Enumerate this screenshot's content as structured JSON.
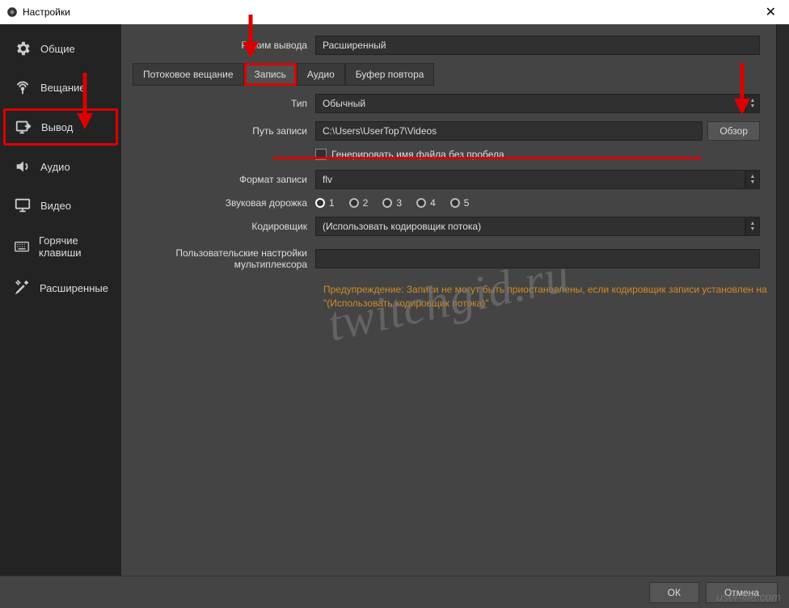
{
  "titlebar": {
    "title": "Настройки"
  },
  "sidebar": {
    "items": [
      {
        "label": "Общие",
        "icon": "gear-icon"
      },
      {
        "label": "Вещание",
        "icon": "antenna-icon"
      },
      {
        "label": "Вывод",
        "icon": "output-icon",
        "selected": true
      },
      {
        "label": "Аудио",
        "icon": "speaker-icon"
      },
      {
        "label": "Видео",
        "icon": "monitor-icon"
      },
      {
        "label": "Горячие клавиши",
        "icon": "keyboard-icon"
      },
      {
        "label": "Расширенные",
        "icon": "tools-icon"
      }
    ]
  },
  "mode": {
    "label": "Режим вывода",
    "value": "Расширенный"
  },
  "tabs": [
    {
      "label": "Потоковое вещание"
    },
    {
      "label": "Запись",
      "active": true
    },
    {
      "label": "Аудио"
    },
    {
      "label": "Буфер повтора"
    }
  ],
  "form": {
    "type_label": "Тип",
    "type_value": "Обычный",
    "path_label": "Путь записи",
    "path_value": "C:\\Users\\UserTop7\\Videos",
    "browse_label": "Обзор",
    "nospace_label": "Генерировать имя файла без пробела",
    "format_label": "Формат записи",
    "format_value": "flv",
    "track_label": "Звуковая дорожка",
    "tracks": [
      "1",
      "2",
      "3",
      "4",
      "5"
    ],
    "encoder_label": "Кодировщик",
    "encoder_value": "(Использовать кодировщик потока)",
    "mux_label": "Пользовательские настройки мультиплексора",
    "warning": "Предупреждение: Записи не могут быть приостановлены, если кодировщик записи установлен на \"(Использовать кодировщик потока)\""
  },
  "footer": {
    "ok": "ОК",
    "cancel": "Отмена"
  },
  "watermark": "twitchgid.ru",
  "watermark2": "user-life.com"
}
